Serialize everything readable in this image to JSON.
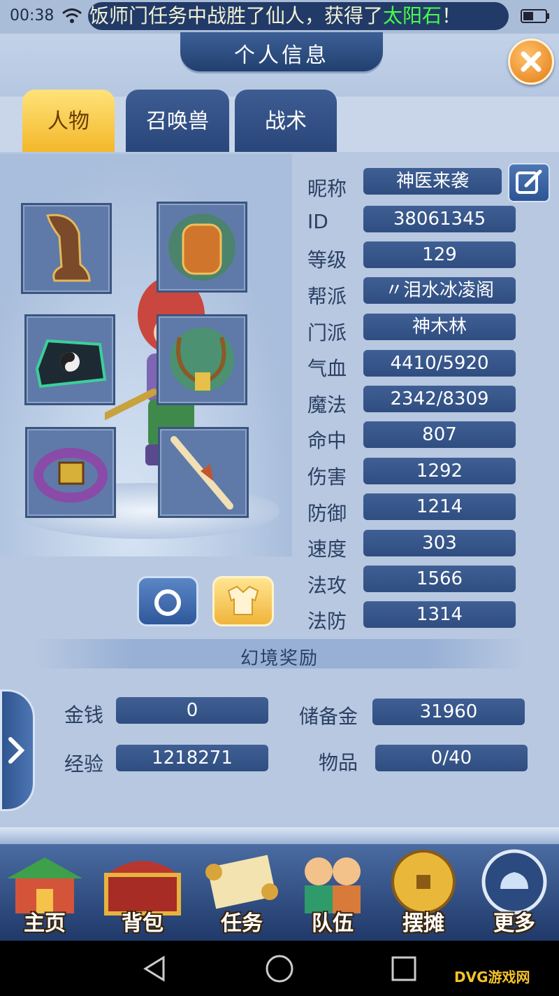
{
  "status_bar": {
    "time": "00:38"
  },
  "marquee": {
    "text": "饭师门任务中战胜了仙人，获得了",
    "highlight": "太阳石",
    "suffix": "！"
  },
  "header": {
    "title": "个人信息"
  },
  "tabs": [
    {
      "label": "人物",
      "active": true
    },
    {
      "label": "召唤兽"
    },
    {
      "label": "战术"
    }
  ],
  "equipment": [
    "boots-icon",
    "armor-icon",
    "hat-icon",
    "necklace-icon",
    "belt-icon",
    "weapon-icon"
  ],
  "stats": [
    {
      "label": "昵称",
      "value": "神医来袭"
    },
    {
      "label": "ID",
      "value": "38061345"
    },
    {
      "label": "等级",
      "value": "129"
    },
    {
      "label": "帮派",
      "value": "〃泪水冰凌阁"
    },
    {
      "label": "门派",
      "value": "神木林"
    },
    {
      "label": "气血",
      "value": "4410/5920"
    },
    {
      "label": "魔法",
      "value": "2342/8309"
    },
    {
      "label": "命中",
      "value": "807"
    },
    {
      "label": "伤害",
      "value": "1292"
    },
    {
      "label": "防御",
      "value": "1214"
    },
    {
      "label": "速度",
      "value": "303"
    },
    {
      "label": "法攻",
      "value": "1566"
    },
    {
      "label": "法防",
      "value": "1314"
    }
  ],
  "reward": {
    "title": "幻境奖励",
    "gold_label": "金钱",
    "gold_value": "0",
    "reserve_label": "储备金",
    "reserve_value": "31960",
    "exp_label": "经验",
    "exp_value": "1218271",
    "items_label": "物品",
    "items_value": "0/40"
  },
  "nav": [
    {
      "label": "主页"
    },
    {
      "label": "背包"
    },
    {
      "label": "任务"
    },
    {
      "label": "队伍"
    },
    {
      "label": "摆摊"
    },
    {
      "label": "更多"
    }
  ],
  "watermark": {
    "text": "DVG游戏网"
  },
  "colors": {
    "accent_gold": "#f3b729",
    "panel_blue": "#2f4d80",
    "marquee_highlight": "#46ff48"
  }
}
